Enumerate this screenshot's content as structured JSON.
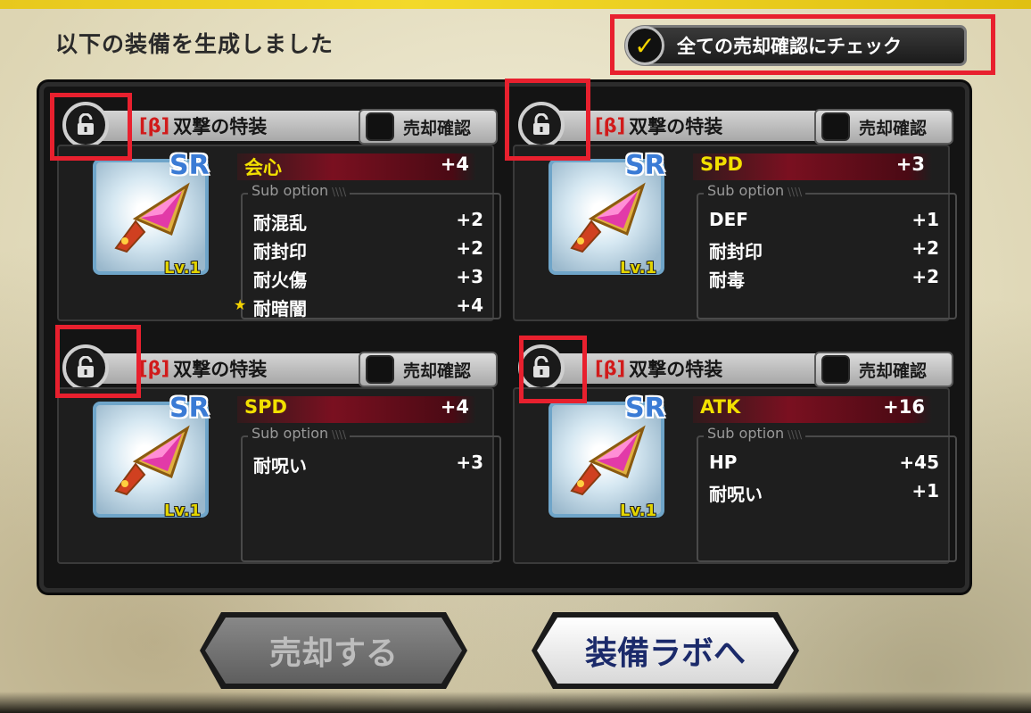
{
  "header": {
    "title": "以下の装備を生成しました",
    "check_all_label": "全ての売却確認にチェック",
    "check_icon": "checkmark-icon"
  },
  "common": {
    "sub_option_title": "Sub option",
    "sell_confirm_label": "売却確認",
    "rarity": "SR",
    "level": "Lv.1",
    "beta_tag": "[β]",
    "item_name": "双撃の特装"
  },
  "cards": [
    {
      "main_stat": {
        "name": "会心",
        "value": "+4"
      },
      "sub_options": [
        {
          "name": "耐混乱",
          "value": "+2",
          "star": false
        },
        {
          "name": "耐封印",
          "value": "+2",
          "star": false
        },
        {
          "name": "耐火傷",
          "value": "+3",
          "star": false
        },
        {
          "name": "耐暗闇",
          "value": "+4",
          "star": true
        }
      ]
    },
    {
      "main_stat": {
        "name": "SPD",
        "value": "+3"
      },
      "sub_options": [
        {
          "name": "DEF",
          "value": "+1",
          "star": false
        },
        {
          "name": "耐封印",
          "value": "+2",
          "star": false
        },
        {
          "name": "耐毒",
          "value": "+2",
          "star": false
        }
      ]
    },
    {
      "main_stat": {
        "name": "SPD",
        "value": "+4"
      },
      "sub_options": [
        {
          "name": "耐呪い",
          "value": "+3",
          "star": false
        }
      ]
    },
    {
      "main_stat": {
        "name": "ATK",
        "value": "+16"
      },
      "sub_options": [
        {
          "name": "HP",
          "value": "+45",
          "star": false
        },
        {
          "name": "耐呪い",
          "value": "+1",
          "star": false
        }
      ]
    }
  ],
  "buttons": {
    "sell": "売却する",
    "lab": "装備ラボへ"
  },
  "colors": {
    "highlight_red": "#e8202e",
    "main_stat_yellow": "#f2e000",
    "beta_red": "#d11b1b"
  }
}
